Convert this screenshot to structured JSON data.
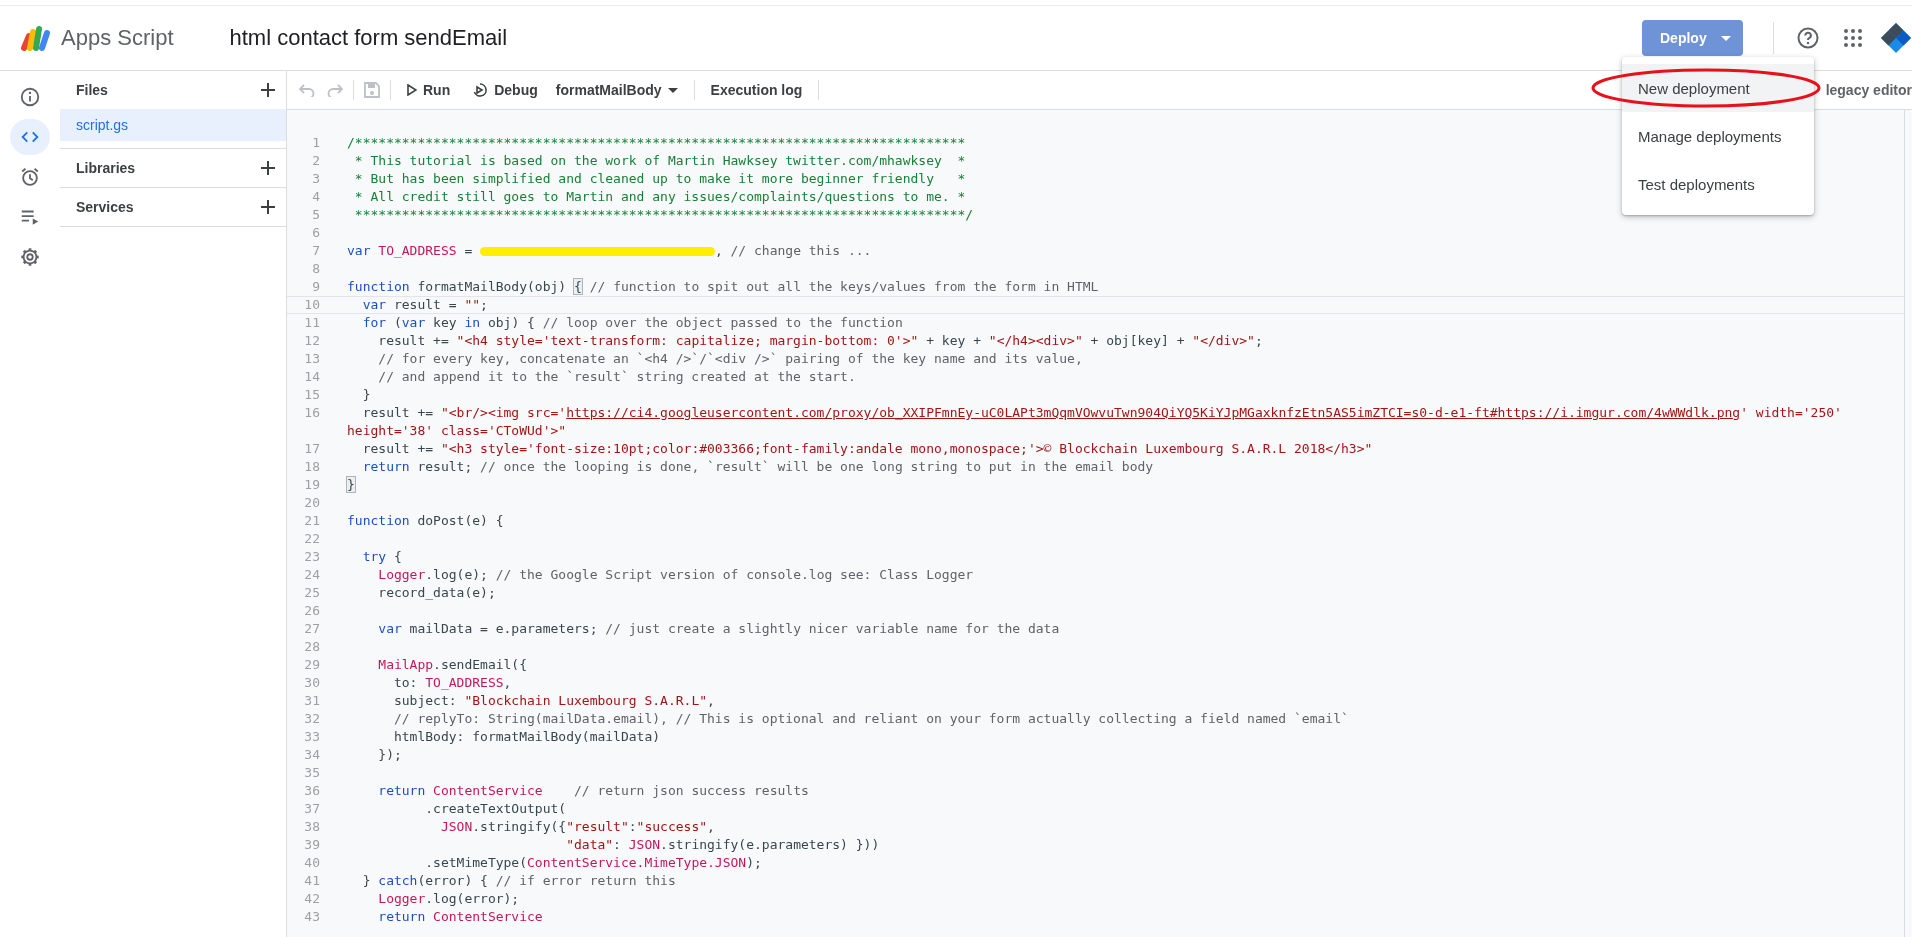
{
  "header": {
    "app_name": "Apps Script",
    "project_title": "html contact form sendEmail",
    "deploy_button": "Deploy"
  },
  "deploy_menu": {
    "items": [
      {
        "label": "New deployment",
        "selected": true,
        "circled": true
      },
      {
        "label": "Manage deployments",
        "selected": false,
        "circled": false
      },
      {
        "label": "Test deployments",
        "selected": false,
        "circled": false
      }
    ]
  },
  "rail": {
    "items": [
      {
        "kind": "info",
        "selected": false
      },
      {
        "kind": "code",
        "selected": true
      },
      {
        "kind": "triggers",
        "selected": false
      },
      {
        "kind": "executions",
        "selected": false
      },
      {
        "kind": "settings",
        "selected": false
      }
    ]
  },
  "files_panel": {
    "sections": [
      {
        "title": "Files",
        "files": [
          {
            "name": "script.gs",
            "selected": true
          }
        ]
      },
      {
        "title": "Libraries"
      },
      {
        "title": "Services"
      }
    ]
  },
  "toolbar": {
    "undo": {
      "disabled": true
    },
    "redo": {
      "disabled": true
    },
    "save": {
      "disabled": true
    },
    "run": "Run",
    "debug": "Debug",
    "function_select": "formatMailBody",
    "execution_log": "Execution log",
    "legacy_editor": "legacy editor"
  },
  "editor": {
    "lines": [
      {
        "number": "1",
        "active": false,
        "tokens": [
          {
            "kind": "doc",
            "text": "/******************************************************************************"
          }
        ]
      },
      {
        "number": "2",
        "active": false,
        "tokens": [
          {
            "kind": "doc",
            "text": " * This tutorial is based on the work of Martin Hawksey twitter.com/mhawksey  *"
          }
        ]
      },
      {
        "number": "3",
        "active": false,
        "tokens": [
          {
            "kind": "doc",
            "text": " * But has been simplified and cleaned up to make it more beginner friendly   *"
          }
        ]
      },
      {
        "number": "4",
        "active": false,
        "tokens": [
          {
            "kind": "doc",
            "text": " * All credit still goes to Martin and any issues/complaints/questions to me. *"
          }
        ]
      },
      {
        "number": "5",
        "active": false,
        "tokens": [
          {
            "kind": "doc",
            "text": " ******************************************************************************/"
          }
        ]
      },
      {
        "number": "6",
        "active": false
      },
      {
        "number": "7",
        "active": false,
        "tokens": [
          {
            "kind": "keyword",
            "text": "var "
          },
          {
            "kind": "builtin",
            "text": "TO_ADDRESS"
          },
          {
            "kind": "plain",
            "text": " = "
          },
          {
            "kind": "redaction"
          },
          {
            "kind": "plain",
            "text": ", "
          },
          {
            "kind": "comment",
            "text": "// change this ..."
          }
        ]
      },
      {
        "number": "8",
        "active": false
      },
      {
        "number": "9",
        "active": false,
        "tokens": [
          {
            "kind": "keyword",
            "text": "function"
          },
          {
            "kind": "plain",
            "text": " formatMailBody(obj) "
          },
          {
            "kind": "bracket",
            "text": "{"
          },
          {
            "kind": "comment",
            "text": " // function to spit out all the keys/values from the form in HTML"
          }
        ]
      },
      {
        "number": "10",
        "active": true,
        "tokens": [
          {
            "kind": "keyword",
            "text": "  var"
          },
          {
            "kind": "plain",
            "text": " result = "
          },
          {
            "kind": "string",
            "text": "\"\""
          },
          {
            "kind": "plain",
            "text": ";"
          }
        ]
      },
      {
        "number": "11",
        "active": false,
        "tokens": [
          {
            "kind": "keyword",
            "text": "  for"
          },
          {
            "kind": "plain",
            "text": " ("
          },
          {
            "kind": "keyword",
            "text": "var"
          },
          {
            "kind": "plain",
            "text": " key "
          },
          {
            "kind": "keyword",
            "text": "in"
          },
          {
            "kind": "plain",
            "text": " obj) { "
          },
          {
            "kind": "comment",
            "text": "// loop over the object passed to the function"
          }
        ]
      },
      {
        "number": "12",
        "active": false,
        "tokens": [
          {
            "kind": "plain",
            "text": "    result += "
          },
          {
            "kind": "string",
            "text": "\"<h4 style='text-transform: capitalize; margin-bottom: 0'>\""
          },
          {
            "kind": "plain",
            "text": " + key + "
          },
          {
            "kind": "string",
            "text": "\"</h4><div>\""
          },
          {
            "kind": "plain",
            "text": " + obj[key] + "
          },
          {
            "kind": "string",
            "text": "\"</div>\""
          },
          {
            "kind": "plain",
            "text": ";"
          }
        ]
      },
      {
        "number": "13",
        "active": false,
        "tokens": [
          {
            "kind": "comment",
            "text": "    // for every key, concatenate an `<h4 />`/`<div />` pairing of the key name and its value,"
          }
        ]
      },
      {
        "number": "14",
        "active": false,
        "tokens": [
          {
            "kind": "comment",
            "text": "    // and append it to the `result` string created at the start."
          }
        ]
      },
      {
        "number": "15",
        "active": false,
        "tokens": [
          {
            "kind": "plain",
            "text": "  }"
          }
        ]
      },
      {
        "number": "16",
        "active": false,
        "tokens": [
          {
            "kind": "plain",
            "text": "  result += "
          },
          {
            "kind": "string",
            "text": "\"<br/><img src='"
          },
          {
            "kind": "link",
            "text": "https://ci4.googleusercontent.com/proxy/ob_XXIPFmnEy-uC0LAPt3mQqmVOwvuTwn904QiYQ5KiYJpMGaxknfzEtn5AS5imZTCI=s0-d-e1-ft#https://i.imgur.com/4wWWdlk.png"
          },
          {
            "kind": "string",
            "text": "' width='250'"
          }
        ],
        "continuation": [
          {
            "kind": "string",
            "text": "height='38' class='CToWUd'>\""
          }
        ]
      },
      {
        "number": "17",
        "active": false,
        "tokens": [
          {
            "kind": "plain",
            "text": "  result += "
          },
          {
            "kind": "string",
            "text": "\"<h3 style='font-size:10pt;color:#003366;font-family:andale mono,monospace;'>© Blockchain Luxembourg S.A.R.L 2018</h3>\""
          }
        ]
      },
      {
        "number": "18",
        "active": false,
        "tokens": [
          {
            "kind": "keyword",
            "text": "  return"
          },
          {
            "kind": "plain",
            "text": " result; "
          },
          {
            "kind": "comment",
            "text": "// once the looping is done, `result` will be one long string to put in the email body"
          }
        ]
      },
      {
        "number": "19",
        "active": false,
        "tokens": [
          {
            "kind": "bracket",
            "text": "}"
          }
        ]
      },
      {
        "number": "20",
        "active": false
      },
      {
        "number": "21",
        "active": false,
        "tokens": [
          {
            "kind": "keyword",
            "text": "function"
          },
          {
            "kind": "plain",
            "text": " doPost(e) {"
          }
        ]
      },
      {
        "number": "22",
        "active": false
      },
      {
        "number": "23",
        "active": false,
        "tokens": [
          {
            "kind": "keyword",
            "text": "  try"
          },
          {
            "kind": "plain",
            "text": " {"
          }
        ]
      },
      {
        "number": "24",
        "active": false,
        "tokens": [
          {
            "kind": "builtin",
            "text": "    Logger"
          },
          {
            "kind": "plain",
            "text": ".log(e); "
          },
          {
            "kind": "comment",
            "text": "// the Google Script version of console.log see: Class Logger"
          }
        ]
      },
      {
        "number": "25",
        "active": false,
        "tokens": [
          {
            "kind": "plain",
            "text": "    record_data(e);"
          }
        ]
      },
      {
        "number": "26",
        "active": false
      },
      {
        "number": "27",
        "active": false,
        "tokens": [
          {
            "kind": "keyword",
            "text": "    var"
          },
          {
            "kind": "plain",
            "text": " mailData = e.parameters; "
          },
          {
            "kind": "comment",
            "text": "// just create a slightly nicer variable name for the data"
          }
        ]
      },
      {
        "number": "28",
        "active": false
      },
      {
        "number": "29",
        "active": false,
        "tokens": [
          {
            "kind": "builtin",
            "text": "    MailApp"
          },
          {
            "kind": "plain",
            "text": ".sendEmail({"
          }
        ]
      },
      {
        "number": "30",
        "active": false,
        "tokens": [
          {
            "kind": "plain",
            "text": "      to: "
          },
          {
            "kind": "builtin",
            "text": "TO_ADDRESS"
          },
          {
            "kind": "plain",
            "text": ","
          }
        ]
      },
      {
        "number": "31",
        "active": false,
        "tokens": [
          {
            "kind": "plain",
            "text": "      subject: "
          },
          {
            "kind": "string",
            "text": "\"Blockchain Luxembourg S.A.R.L\""
          },
          {
            "kind": "plain",
            "text": ","
          }
        ]
      },
      {
        "number": "32",
        "active": false,
        "tokens": [
          {
            "kind": "comment",
            "text": "      // replyTo: String(mailData.email), // This is optional and reliant on your form actually collecting a field named `email`"
          }
        ]
      },
      {
        "number": "33",
        "active": false,
        "tokens": [
          {
            "kind": "plain",
            "text": "      htmlBody: formatMailBody(mailData)"
          }
        ]
      },
      {
        "number": "34",
        "active": false,
        "tokens": [
          {
            "kind": "plain",
            "text": "    });"
          }
        ]
      },
      {
        "number": "35",
        "active": false
      },
      {
        "number": "36",
        "active": false,
        "tokens": [
          {
            "kind": "keyword",
            "text": "    return "
          },
          {
            "kind": "builtin",
            "text": "ContentService"
          },
          {
            "kind": "comment",
            "text": "    // return json success results"
          }
        ]
      },
      {
        "number": "37",
        "active": false,
        "tokens": [
          {
            "kind": "plain",
            "text": "          .createTextOutput("
          }
        ]
      },
      {
        "number": "38",
        "active": false,
        "tokens": [
          {
            "kind": "builtin",
            "text": "            JSON"
          },
          {
            "kind": "plain",
            "text": ".stringify({"
          },
          {
            "kind": "string",
            "text": "\"result\""
          },
          {
            "kind": "plain",
            "text": ":"
          },
          {
            "kind": "string",
            "text": "\"success\""
          },
          {
            "kind": "plain",
            "text": ","
          }
        ]
      },
      {
        "number": "39",
        "active": false,
        "tokens": [
          {
            "kind": "string",
            "text": "                            \"data\""
          },
          {
            "kind": "plain",
            "text": ": "
          },
          {
            "kind": "builtin",
            "text": "JSON"
          },
          {
            "kind": "plain",
            "text": ".stringify(e.parameters) }))"
          }
        ]
      },
      {
        "number": "40",
        "active": false,
        "tokens": [
          {
            "kind": "plain",
            "text": "          .setMimeType("
          },
          {
            "kind": "builtin",
            "text": "ContentService.MimeType.JSON"
          },
          {
            "kind": "plain",
            "text": ");"
          }
        ]
      },
      {
        "number": "41",
        "active": false,
        "tokens": [
          {
            "kind": "plain",
            "text": "  } "
          },
          {
            "kind": "keyword",
            "text": "catch"
          },
          {
            "kind": "plain",
            "text": "(error) { "
          },
          {
            "kind": "comment",
            "text": "// if error return this"
          }
        ]
      },
      {
        "number": "42",
        "active": false,
        "tokens": [
          {
            "kind": "builtin",
            "text": "    Logger"
          },
          {
            "kind": "plain",
            "text": ".log(error);"
          }
        ]
      },
      {
        "number": "43",
        "active": false,
        "tokens": [
          {
            "kind": "keyword",
            "text": "    return "
          },
          {
            "kind": "builtin",
            "text": "ContentService"
          }
        ]
      }
    ]
  }
}
